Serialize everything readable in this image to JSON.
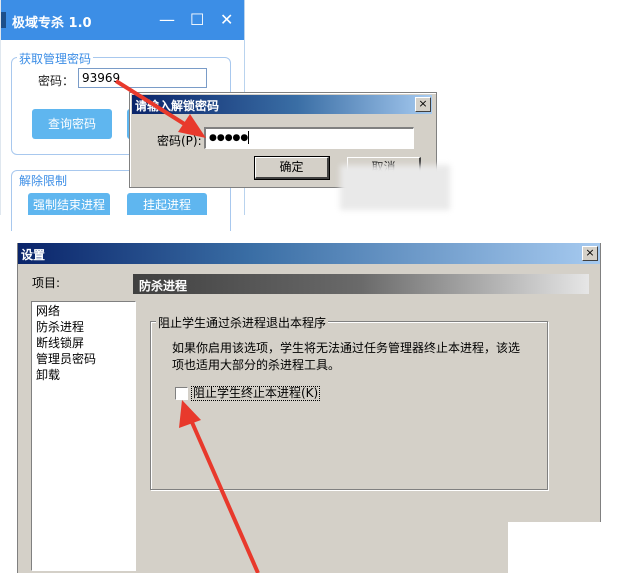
{
  "app": {
    "title": "极域专杀 1.0",
    "controls": {
      "minimize": "—",
      "maximize": "☐",
      "close": "✕"
    },
    "get_password_group": "获取管理密码",
    "password_label": "密码：",
    "password_value": "93969",
    "query_button": "查询密码",
    "release_group": "解除限制",
    "force_kill_button": "强制结束进程",
    "suspend_button": "挂起进程"
  },
  "unlock_dialog": {
    "title": "请输入解锁密码",
    "password_label": "密码(P):",
    "password_value": "●●●●●",
    "ok_button": "确定",
    "cancel_button": "取消",
    "close": "×"
  },
  "settings": {
    "title": "设置",
    "close": "×",
    "items_label": "项目:",
    "items": [
      "网络",
      "防杀进程",
      "断线锁屏",
      "管理员密码",
      "卸载"
    ],
    "section_title": "防杀进程",
    "group_title": "阻止学生通过杀进程退出本程序",
    "description_line1": "如果你启用该选项，学生将无法通过任务管理器终止本进程，该选",
    "description_line2": "项也适用大部分的杀进程工具。",
    "checkbox_label": "阻止学生终止本进程(K)",
    "checkbox_checked": false
  },
  "colors": {
    "app_accent": "#3c8ee6",
    "app_button": "#5fb6ef",
    "classic_face": "#d4d0c8",
    "annotation_arrow": "#e8392c"
  }
}
